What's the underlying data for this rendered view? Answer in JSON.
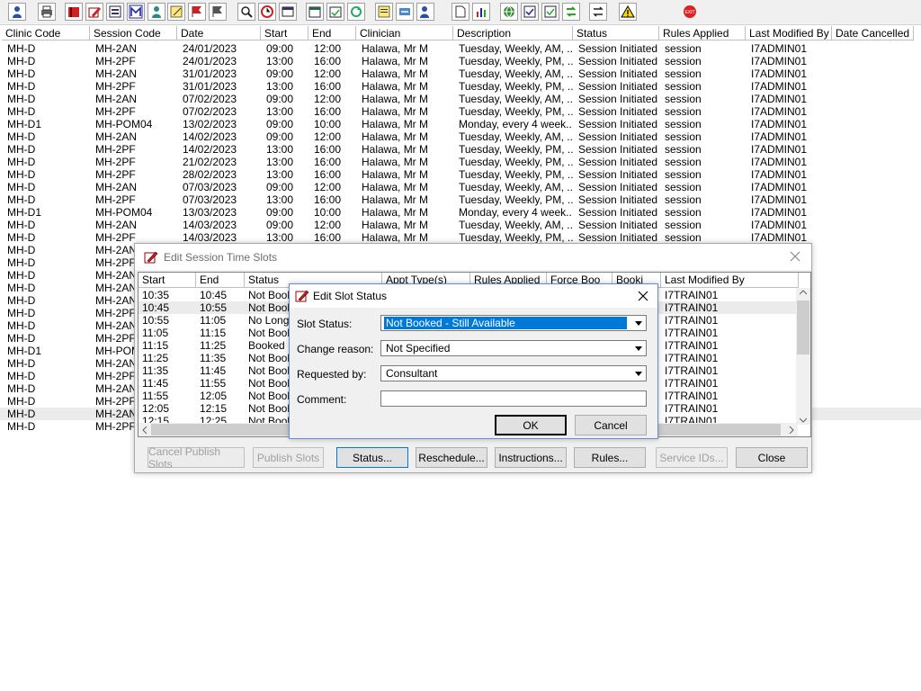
{
  "toolbar": {
    "icons": [
      "user-icon",
      "printer-icon",
      "book-icon",
      "edit-book-icon",
      "report-icon",
      "m-icon",
      "person-icon",
      "notes-icon",
      "flag-icon",
      "flag2-icon",
      "search-icon",
      "clock-icon",
      "window-icon",
      "calendar-icon",
      "schedule-icon",
      "refresh-icon",
      "memo-icon",
      "transfer-icon",
      "user-edit-icon",
      "document-icon",
      "chart-icon",
      "globe-icon",
      "check-list-icon",
      "check-list2-icon",
      "green-arrows-icon",
      "swap-icon",
      "warning-icon",
      "exit-icon"
    ]
  },
  "grid": {
    "headers": [
      "Clinic Code",
      "Session Code",
      "Date",
      "Start",
      "End",
      "Clinician",
      "Description",
      "Status",
      "Rules Applied",
      "Last Modified By",
      "Date Cancelled"
    ],
    "rows": [
      [
        "MH-D",
        "MH-2AN",
        "24/01/2023",
        "09:00",
        "12:00",
        "Halawa, Mr M",
        "Tuesday, Weekly, AM, ...",
        "Session Initiated",
        "session",
        "I7ADMIN01",
        ""
      ],
      [
        "MH-D",
        "MH-2PF",
        "24/01/2023",
        "13:00",
        "16:00",
        "Halawa, Mr M",
        "Tuesday, Weekly, PM, ...",
        "Session Initiated",
        "session",
        "I7ADMIN01",
        ""
      ],
      [
        "MH-D",
        "MH-2AN",
        "31/01/2023",
        "09:00",
        "12:00",
        "Halawa, Mr M",
        "Tuesday, Weekly, AM, ...",
        "Session Initiated",
        "session",
        "I7ADMIN01",
        ""
      ],
      [
        "MH-D",
        "MH-2PF",
        "31/01/2023",
        "13:00",
        "16:00",
        "Halawa, Mr M",
        "Tuesday, Weekly, PM, ...",
        "Session Initiated",
        "session",
        "I7ADMIN01",
        ""
      ],
      [
        "MH-D",
        "MH-2AN",
        "07/02/2023",
        "09:00",
        "12:00",
        "Halawa, Mr M",
        "Tuesday, Weekly, AM, ...",
        "Session Initiated",
        "session",
        "I7ADMIN01",
        ""
      ],
      [
        "MH-D",
        "MH-2PF",
        "07/02/2023",
        "13:00",
        "16:00",
        "Halawa, Mr M",
        "Tuesday, Weekly, PM, ...",
        "Session Initiated",
        "session",
        "I7ADMIN01",
        ""
      ],
      [
        "MH-D1",
        "MH-POM04",
        "13/02/2023",
        "09:00",
        "10:00",
        "Halawa, Mr M",
        "Monday, every 4 week...",
        "Session Initiated",
        "session",
        "I7ADMIN01",
        ""
      ],
      [
        "MH-D",
        "MH-2AN",
        "14/02/2023",
        "09:00",
        "12:00",
        "Halawa, Mr M",
        "Tuesday, Weekly, AM, ...",
        "Session Initiated",
        "session",
        "I7ADMIN01",
        ""
      ],
      [
        "MH-D",
        "MH-2PF",
        "14/02/2023",
        "13:00",
        "16:00",
        "Halawa, Mr M",
        "Tuesday, Weekly, PM, ...",
        "Session Initiated",
        "session",
        "I7ADMIN01",
        ""
      ],
      [
        "MH-D",
        "MH-2PF",
        "21/02/2023",
        "13:00",
        "16:00",
        "Halawa, Mr M",
        "Tuesday, Weekly, PM, ...",
        "Session Initiated",
        "session",
        "I7ADMIN01",
        ""
      ],
      [
        "MH-D",
        "MH-2PF",
        "28/02/2023",
        "13:00",
        "16:00",
        "Halawa, Mr M",
        "Tuesday, Weekly, PM, ...",
        "Session Initiated",
        "session",
        "I7ADMIN01",
        ""
      ],
      [
        "MH-D",
        "MH-2AN",
        "07/03/2023",
        "09:00",
        "12:00",
        "Halawa, Mr M",
        "Tuesday, Weekly, AM, ...",
        "Session Initiated",
        "session",
        "I7ADMIN01",
        ""
      ],
      [
        "MH-D",
        "MH-2PF",
        "07/03/2023",
        "13:00",
        "16:00",
        "Halawa, Mr M",
        "Tuesday, Weekly, PM, ...",
        "Session Initiated",
        "session",
        "I7ADMIN01",
        ""
      ],
      [
        "MH-D1",
        "MH-POM04",
        "13/03/2023",
        "09:00",
        "10:00",
        "Halawa, Mr M",
        "Monday, every 4 week...",
        "Session Initiated",
        "session",
        "I7ADMIN01",
        ""
      ],
      [
        "MH-D",
        "MH-2AN",
        "14/03/2023",
        "09:00",
        "12:00",
        "Halawa, Mr M",
        "Tuesday, Weekly, AM, ...",
        "Session Initiated",
        "session",
        "I7ADMIN01",
        ""
      ],
      [
        "MH-D",
        "MH-2PF",
        "14/03/2023",
        "13:00",
        "16:00",
        "Halawa, Mr M",
        "Tuesday, Weekly, PM, ...",
        "Session Initiated",
        "session",
        "I7ADMIN01",
        ""
      ],
      [
        "MH-D",
        "MH-2AN"
      ],
      [
        "MH-D",
        "MH-2PF"
      ],
      [
        "MH-D",
        "MH-2AN"
      ],
      [
        "MH-D",
        "MH-2AN"
      ],
      [
        "MH-D",
        "MH-2AN"
      ],
      [
        "MH-D",
        "MH-2PF"
      ],
      [
        "MH-D",
        "MH-2AN"
      ],
      [
        "MH-D",
        "MH-2PF"
      ],
      [
        "MH-D1",
        "MH-POM"
      ],
      [
        "MH-D",
        "MH-2AN"
      ],
      [
        "MH-D",
        "MH-2PF"
      ],
      [
        "MH-D",
        "MH-2AN"
      ],
      [
        "MH-D",
        "MH-2PF"
      ],
      [
        "MH-D",
        "MH-2AN"
      ],
      [
        "MH-D",
        "MH-2PF"
      ]
    ],
    "selected_row": 29
  },
  "session_dialog": {
    "title": "Edit Session Time Slots",
    "headers": [
      "Start",
      "End",
      "Status",
      "Appt Type(s)",
      "Rules Applied",
      "Force Boo",
      "Booki",
      "Last Modified By"
    ],
    "rows": [
      [
        "10:35",
        "10:45",
        "Not Book",
        "",
        "",
        "",
        "",
        "I7TRAIN01"
      ],
      [
        "10:45",
        "10:55",
        "Not Book",
        "",
        "",
        "",
        "",
        "I7TRAIN01"
      ],
      [
        "10:55",
        "11:05",
        "No Longe",
        "",
        "",
        "",
        "",
        "I7TRAIN01"
      ],
      [
        "11:05",
        "11:15",
        "Not Book",
        "",
        "",
        "",
        "",
        "I7TRAIN01"
      ],
      [
        "11:15",
        "11:25",
        "Booked",
        "",
        "",
        "",
        "",
        "I7TRAIN01"
      ],
      [
        "11:25",
        "11:35",
        "Not Book",
        "",
        "",
        "",
        "",
        "I7TRAIN01"
      ],
      [
        "11:35",
        "11:45",
        "Not Book",
        "",
        "",
        "",
        "",
        "I7TRAIN01"
      ],
      [
        "11:45",
        "11:55",
        "Not Book",
        "",
        "",
        "",
        "",
        "I7TRAIN01"
      ],
      [
        "11:55",
        "12:05",
        "Not Book",
        "",
        "",
        "",
        "",
        "I7TRAIN01"
      ],
      [
        "12:05",
        "12:15",
        "Not Book",
        "",
        "",
        "",
        "",
        "I7TRAIN01"
      ],
      [
        "12:15",
        "12:25",
        "Not Book",
        "",
        "",
        "",
        "",
        "I7TRAIN01"
      ]
    ],
    "selected_row": 1,
    "buttons": {
      "cancel_publish": "Cancel Publish Slots",
      "publish": "Publish Slots",
      "status": "Status...",
      "reschedule": "Reschedule...",
      "instructions": "Instructions...",
      "rules": "Rules...",
      "service_ids": "Service IDs...",
      "close": "Close"
    }
  },
  "status_dialog": {
    "title": "Edit Slot Status",
    "slot_status_label": "Slot Status:",
    "slot_status_value": "Not Booked - Still Available",
    "change_reason_label": "Change reason:",
    "change_reason_value": "Not Specified",
    "requested_by_label": "Requested by:",
    "requested_by_value": "Consultant",
    "comment_label": "Comment:",
    "comment_value": "",
    "ok": "OK",
    "cancel": "Cancel"
  },
  "colors": {
    "selection": "#0078d7",
    "row_highlight": "#ebebeb",
    "dialog_bg": "#f0f0f0"
  }
}
